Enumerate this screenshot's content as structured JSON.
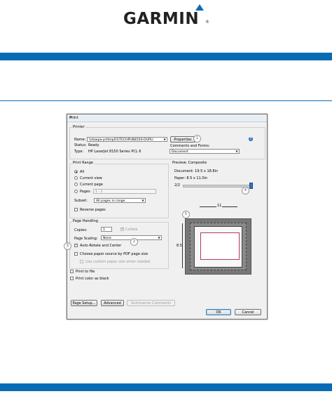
{
  "brand": {
    "logo_text": "GARMIN",
    "registered_mark": "®"
  },
  "colors": {
    "band": "#0a6bb5",
    "logo_triangle": "#0a6bb5"
  },
  "dialog": {
    "title": "Print",
    "close_glyph": "✕",
    "printer": {
      "group_label": "Printer",
      "name_label": "Name:",
      "name_value": "\\\\dawpa-prttmp01\\TECHPUB8150-DUPLI",
      "properties_label": "Properties",
      "status_label": "Status:",
      "status_value": "Ready",
      "type_label": "Type:",
      "type_value": "HP LaserJet 8150 Series PCL 6",
      "comments_label": "Comments and Forms:",
      "comments_value": "Document",
      "help_glyph": "?"
    },
    "print_range": {
      "group_label": "Print Range",
      "all_label": "All",
      "current_view_label": "Current view",
      "current_page_label": "Current page",
      "pages_label": "Pages",
      "pages_value": "1 - 2",
      "subset_label": "Subset:",
      "subset_value": "All pages in range",
      "reverse_label": "Reverse pages"
    },
    "page_handling": {
      "group_label": "Page Handling",
      "copies_label": "Copies:",
      "copies_value": "1",
      "collate_label": "Collate",
      "scaling_label": "Page Scaling:",
      "scaling_value": "None",
      "auto_rotate_label": "Auto-Rotate and Center",
      "choose_source_label": "Choose paper source by PDF page size",
      "custom_paper_label": "Use custom paper size when needed"
    },
    "print_to_file_label": "Print to file",
    "print_color_label": "Print color as black",
    "preview": {
      "header": "Preview: Composite",
      "document_size": "Document: 19.5 x 18.8in",
      "paper_size": "Paper: 8.5 x 11.0in",
      "page_indicator": "2/2",
      "width_label": "11",
      "height_label": "8.5"
    },
    "buttons": {
      "page_setup": "Page Setup...",
      "advanced": "Advanced",
      "summarize": "Summarize Comments",
      "ok": "OK",
      "cancel": "Cancel"
    },
    "callouts": {
      "c1": "1",
      "c2": "2",
      "c3": "3",
      "c4": "4",
      "c5": "5"
    }
  }
}
